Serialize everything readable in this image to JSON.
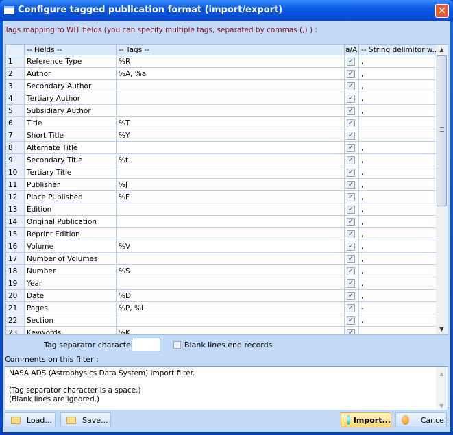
{
  "window": {
    "title": "Configure tagged publication format (import/export)",
    "close": "✕"
  },
  "hint": "Tags mapping to WIT fields (you can specify multiple tags, separated by commas (,) ) :",
  "grid": {
    "headers": [
      "",
      "-- Fields --",
      "-- Tags --",
      "a/A",
      "-- String delimitor w..."
    ],
    "rows": [
      {
        "n": "1",
        "field": "Reference Type",
        "tags": "%R",
        "case": true,
        "delim": ","
      },
      {
        "n": "2",
        "field": "Author",
        "tags": "%A, %a",
        "case": true,
        "delim": ","
      },
      {
        "n": "3",
        "field": "Secondary Author",
        "tags": "",
        "case": true,
        "delim": ","
      },
      {
        "n": "4",
        "field": "Tertiary Author",
        "tags": "",
        "case": true,
        "delim": ","
      },
      {
        "n": "5",
        "field": "Subsidiary Author",
        "tags": "",
        "case": true,
        "delim": ","
      },
      {
        "n": "6",
        "field": "Title",
        "tags": "%T",
        "case": true,
        "delim": ""
      },
      {
        "n": "7",
        "field": "Short Title",
        "tags": "%Y",
        "case": true,
        "delim": ""
      },
      {
        "n": "8",
        "field": "Alternate Title",
        "tags": "",
        "case": true,
        "delim": ","
      },
      {
        "n": "9",
        "field": "Secondary Title",
        "tags": "%t",
        "case": true,
        "delim": ","
      },
      {
        "n": "10",
        "field": "Tertiary Title",
        "tags": "",
        "case": true,
        "delim": ","
      },
      {
        "n": "11",
        "field": "Publisher",
        "tags": "%J",
        "case": true,
        "delim": ","
      },
      {
        "n": "12",
        "field": "Place Published",
        "tags": "%F",
        "case": true,
        "delim": ","
      },
      {
        "n": "13",
        "field": "Edition",
        "tags": "",
        "case": true,
        "delim": ","
      },
      {
        "n": "14",
        "field": "Original Publication",
        "tags": "",
        "case": true,
        "delim": ","
      },
      {
        "n": "15",
        "field": "Reprint Edition",
        "tags": "",
        "case": true,
        "delim": ","
      },
      {
        "n": "16",
        "field": "Volume",
        "tags": "%V",
        "case": true,
        "delim": ","
      },
      {
        "n": "17",
        "field": "Number of Volumes",
        "tags": "",
        "case": true,
        "delim": ","
      },
      {
        "n": "18",
        "field": "Number",
        "tags": "%S",
        "case": true,
        "delim": ","
      },
      {
        "n": "19",
        "field": "Year",
        "tags": "",
        "case": true,
        "delim": ","
      },
      {
        "n": "20",
        "field": "Date",
        "tags": "%D",
        "case": true,
        "delim": ","
      },
      {
        "n": "21",
        "field": "Pages",
        "tags": "%P, %L",
        "case": true,
        "delim": "-"
      },
      {
        "n": "22",
        "field": "Section",
        "tags": "",
        "case": true,
        "delim": ","
      },
      {
        "n": "23",
        "field": "Keywords",
        "tags": "%K",
        "case": true,
        "delim": ""
      }
    ]
  },
  "separator": {
    "label": "Tag separator character :",
    "value": " "
  },
  "blank_lines": {
    "label": "Blank lines end records",
    "checked": false
  },
  "comments": {
    "label": "Comments on this filter :",
    "text": "NASA ADS (Astrophysics Data System) import filter.\n\n(Tag separator character is a space.)\n(Blank lines are ignored.)"
  },
  "buttons": {
    "load": "Load...",
    "save": "Save...",
    "import": "Import...",
    "cancel": "Cancel"
  },
  "colors": {
    "title": "#0b5ae6",
    "client": "#c2daf8",
    "hint": "#8b1010"
  }
}
